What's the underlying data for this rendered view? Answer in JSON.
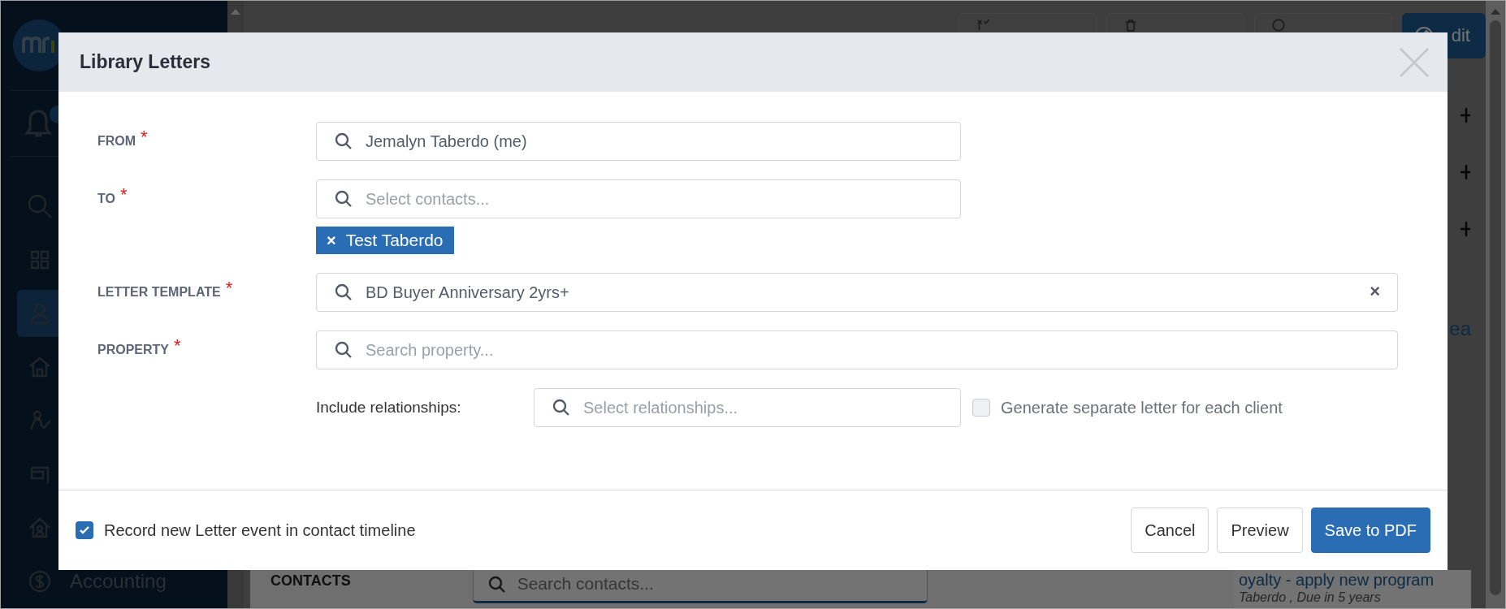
{
  "sidebar": {
    "items": [
      {
        "kind": "search",
        "selected": false
      },
      {
        "kind": "grid",
        "selected": false
      },
      {
        "kind": "person",
        "selected": true
      },
      {
        "kind": "home",
        "selected": false
      },
      {
        "kind": "task",
        "selected": false
      },
      {
        "kind": "board",
        "selected": false
      },
      {
        "kind": "house",
        "selected": false
      },
      {
        "kind": "dollar",
        "selected": false,
        "label": "Accounting"
      }
    ]
  },
  "page": {
    "actions": [
      {
        "kind": "aml",
        "primary": false
      },
      {
        "kind": "delete",
        "primary": false
      },
      {
        "kind": "more",
        "primary": false
      },
      {
        "kind": "edit",
        "label": "dit",
        "primary": true
      }
    ],
    "contacts": {
      "heading": "CONTACTS",
      "placeholder": "Search contacts..."
    },
    "side_panel": {
      "link": "ea",
      "task": "oyalty - apply new program",
      "due": "Taberdo , Due in 5 years"
    }
  },
  "modal": {
    "title": "Library Letters",
    "fields": [
      {
        "label": "FROM",
        "required": "*",
        "wide": false,
        "value": "Jemalyn Taberdo (me)"
      },
      {
        "label": "TO",
        "required": "*",
        "wide": false,
        "placeholder": "Select contacts...",
        "tags": [
          {
            "label": "Test Taberdo",
            "remove": "×"
          }
        ]
      },
      {
        "label": "LETTER TEMPLATE",
        "required": "*",
        "wide": true,
        "value": "BD Buyer Anniversary 2yrs+",
        "clear": "×"
      },
      {
        "label": "PROPERTY",
        "required": "*",
        "wide": true,
        "placeholder": "Search property..."
      }
    ],
    "relationships": {
      "label": "Include relationships:",
      "placeholder": "Select relationships...",
      "separate": {
        "label": "Generate separate letter for each client",
        "checked": false
      }
    },
    "record": {
      "label": "Record new Letter event in contact timeline",
      "checked": true
    },
    "buttons": [
      {
        "label": "Cancel",
        "primary": false
      },
      {
        "label": "Preview",
        "primary": false
      },
      {
        "label": "Save to PDF",
        "primary": true
      }
    ]
  }
}
